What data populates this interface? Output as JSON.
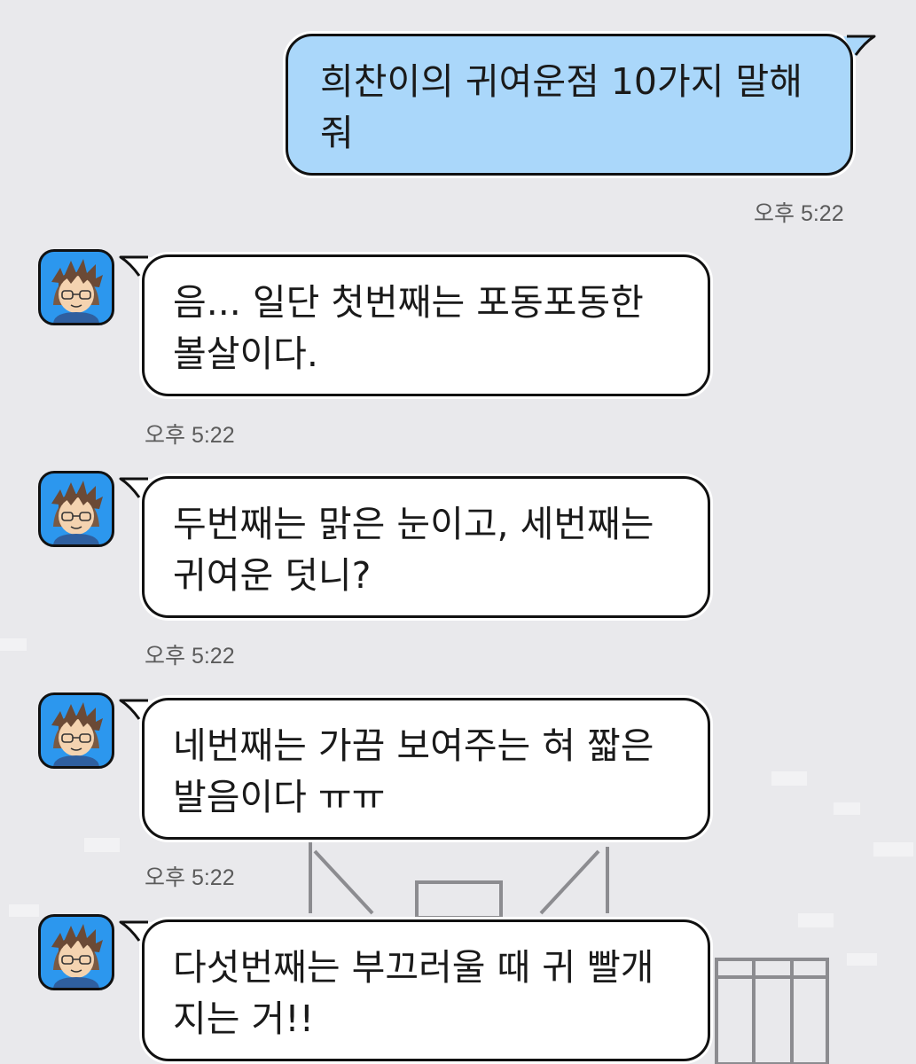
{
  "messages": [
    {
      "direction": "outgoing",
      "text": "희찬이의 귀여운점 10가지 말해\n줘",
      "time": "오후 5:22"
    },
    {
      "direction": "incoming",
      "text": "음... 일단 첫번째는 포동포동한\n볼살이다.",
      "time": "오후 5:22",
      "avatar": "boy-avatar"
    },
    {
      "direction": "incoming",
      "text": "두번째는 맑은 눈이고, 세번째는\n귀여운 덧니?",
      "time": "오후 5:22",
      "avatar": "boy-avatar"
    },
    {
      "direction": "incoming",
      "text": "네번째는 가끔 보여주는 혀 짧은\n발음이다 ㅠㅠ",
      "time": "오후 5:22",
      "avatar": "boy-avatar"
    },
    {
      "direction": "incoming",
      "text": "다섯번째는 부끄러울 때 귀 빨개\n지는 거!!",
      "avatar": "boy-avatar"
    }
  ],
  "colors": {
    "background": "#e9e9ec",
    "outgoing_bubble": "#aad7fa",
    "incoming_bubble": "#ffffff",
    "avatar_bg": "#2c97ee"
  }
}
